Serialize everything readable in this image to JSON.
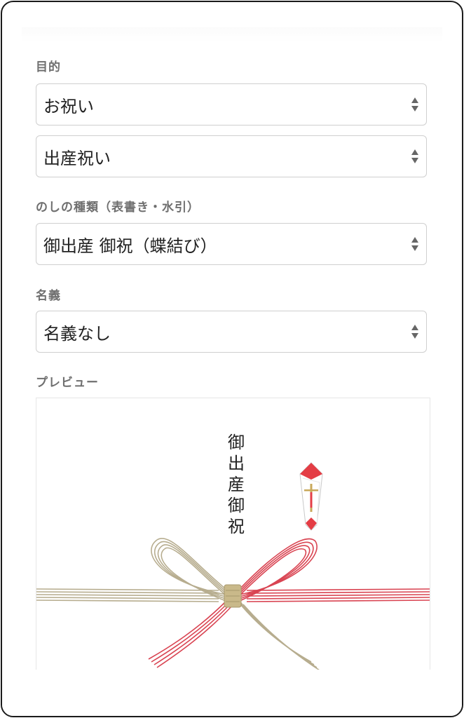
{
  "form": {
    "purpose_label": "目的",
    "purpose_value": "お祝い",
    "subpurpose_value": "出産祝い",
    "noshi_label": "のしの種類（表書き・水引）",
    "noshi_value": "御出産 御祝（蝶結び）",
    "name_label": "名義",
    "name_value": "名義なし"
  },
  "preview": {
    "label": "プレビュー",
    "omotegaki": "御\n出\n産\n御\n祝"
  },
  "colors": {
    "label": "#6f6f6f",
    "border": "#cfcfcf",
    "mizuhiki_red": "#d94452",
    "mizuhiki_gold": "#b7ad8f",
    "noshi_red": "#e43d45"
  },
  "icons": [
    "select-arrows-icon",
    "noshi-ornament-icon",
    "mizuhiki-bow-icon"
  ]
}
